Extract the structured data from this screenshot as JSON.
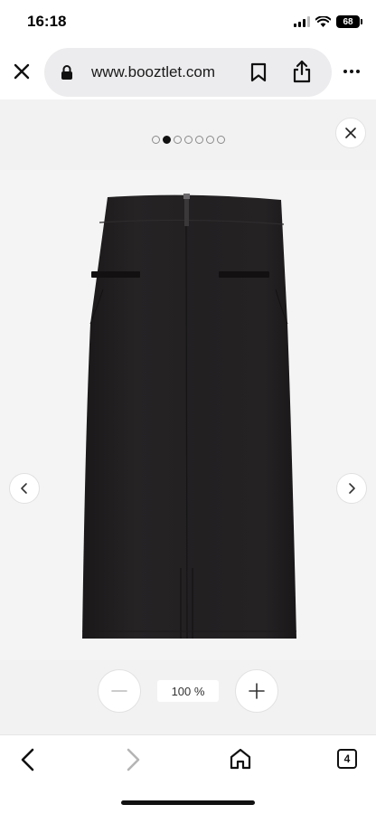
{
  "status_bar": {
    "time": "16:18",
    "battery": "68",
    "icons": [
      "signal-icon",
      "wifi-icon",
      "battery-icon"
    ]
  },
  "browser": {
    "url": "www.booztlet.com",
    "icons": [
      "close-icon",
      "lock-icon",
      "bookmark-icon",
      "share-icon",
      "more-icon"
    ]
  },
  "gallery": {
    "image_count": 7,
    "active_index": 1,
    "product_image": "black-pencil-skirt-back-view",
    "zoom_level": "100 %",
    "icons": [
      "close-icon",
      "chevron-left-icon",
      "chevron-right-icon",
      "minus-icon",
      "plus-icon"
    ]
  },
  "toolbar": {
    "tab_count": "4",
    "icons": [
      "back-icon",
      "forward-icon",
      "home-icon",
      "tabs-icon"
    ]
  },
  "colors": {
    "gallery_bg": "#f2f2f2",
    "skirt": "#211f20",
    "url_pill": "#ececee"
  }
}
